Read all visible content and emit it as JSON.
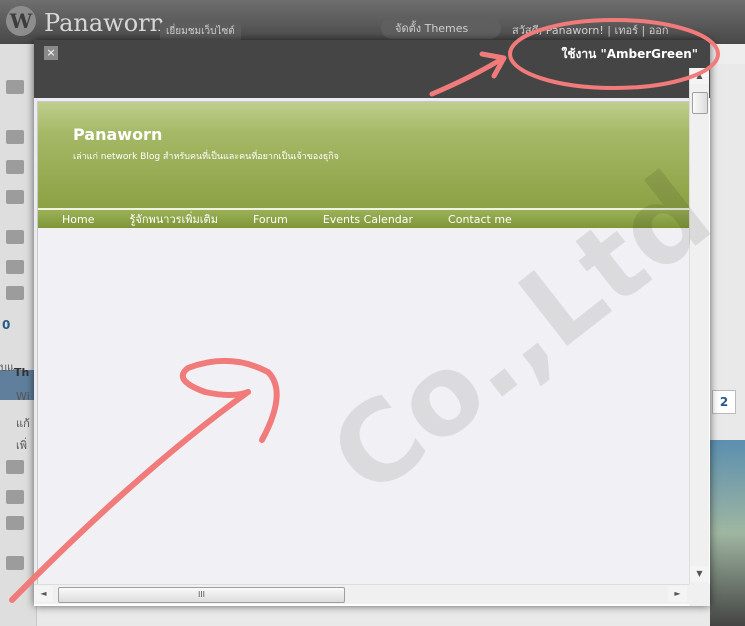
{
  "wp": {
    "logo": "W",
    "site_title": "Panaworn",
    "visit_site": "เยี่ยมชมเว็บไซต์",
    "themes_button": "จัดตั้ง Themes",
    "greeting": "สวัสดี, Panaworn! | เทอร์ | ออก",
    "side_label_1": "Th",
    "side_label_2": "Wi",
    "side_label_3": "แก้",
    "side_label_4": "เพิ่",
    "side_digit": "0",
    "side_extra": "บแ",
    "pager": "2"
  },
  "modal": {
    "close_label": "×",
    "activate_label": "ใช้งาน \"AmberGreen\""
  },
  "theme": {
    "title": "Panaworn",
    "tagline": "เล่าแก่ network Blog สำหรับคนที่เป็นและคนที่อยากเป็นเจ้าของธุกิจ",
    "nav": [
      "Home",
      "รู้จักพนาวรเพิ่มเติม",
      "Forum",
      "Events Calendar",
      "Contact me"
    ]
  },
  "scroll": {
    "up": "▲",
    "down": "▼",
    "left": "◄",
    "right": "►",
    "grip": "III"
  },
  "watermark": "Co.,Ltd",
  "colors": {
    "annotation": "#f17b7b",
    "theme_green": "#8ca144"
  }
}
